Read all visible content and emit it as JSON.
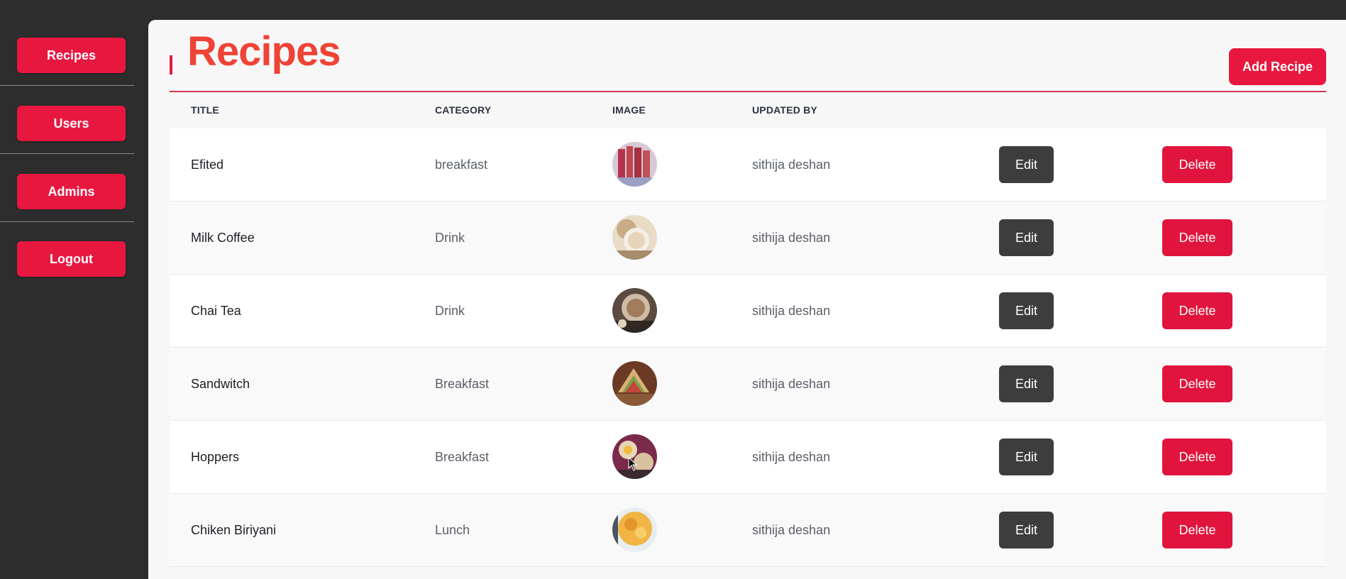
{
  "sidebar": {
    "items": [
      {
        "label": "Recipes"
      },
      {
        "label": "Users"
      },
      {
        "label": "Admins"
      },
      {
        "label": "Logout"
      }
    ]
  },
  "main": {
    "title": "Recipes",
    "add_button": "Add Recipe",
    "columns": {
      "title": "TITLE",
      "category": "CATEGORY",
      "image": "IMAGE",
      "updated_by": "UPDATED BY"
    },
    "row_actions": {
      "edit": "Edit",
      "delete": "Delete"
    },
    "rows": [
      {
        "title": "Efited",
        "category": "breakfast",
        "image": "recipe-thumbnail",
        "updated_by": "sithija deshan"
      },
      {
        "title": "Milk Coffee",
        "category": "Drink",
        "image": "recipe-thumbnail",
        "updated_by": "sithija deshan"
      },
      {
        "title": "Chai Tea",
        "category": "Drink",
        "image": "recipe-thumbnail",
        "updated_by": "sithija deshan"
      },
      {
        "title": "Sandwitch",
        "category": "Breakfast",
        "image": "recipe-thumbnail",
        "updated_by": "sithija deshan"
      },
      {
        "title": "Hoppers",
        "category": "Breakfast",
        "image": "recipe-thumbnail",
        "updated_by": "sithija deshan"
      },
      {
        "title": "Chiken Biriyani",
        "category": "Lunch",
        "image": "recipe-thumbnail",
        "updated_by": "sithija deshan"
      }
    ]
  },
  "colors": {
    "accent": "#e8173f",
    "title": "#ef4335",
    "sidebar_bg": "#2d2d2d",
    "edit_bg": "#3d3d3d"
  }
}
